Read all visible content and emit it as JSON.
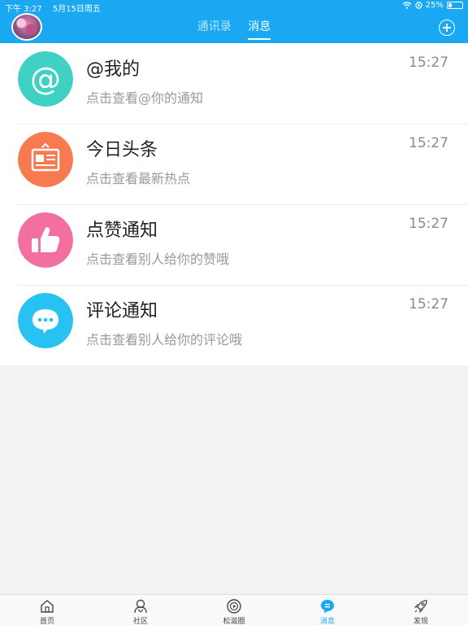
{
  "status": {
    "time": "下午 3:27",
    "date": "5月15日周五",
    "battery": "25%",
    "battery_level": 0.25
  },
  "header": {
    "tabs": [
      {
        "label": "通讯录",
        "active": false
      },
      {
        "label": "消息",
        "active": true
      }
    ]
  },
  "messages": [
    {
      "title": "@我的",
      "subtitle": "点击查看@你的通知",
      "time": "15:27",
      "icon": "at-icon",
      "color": "#3ed1c4"
    },
    {
      "title": "今日头条",
      "subtitle": "点击查看最新热点",
      "time": "15:27",
      "icon": "newspaper-icon",
      "color": "#f87a50"
    },
    {
      "title": "点赞通知",
      "subtitle": "点击查看别人给你的赞哦",
      "time": "15:27",
      "icon": "thumbs-up-icon",
      "color": "#f26fa0"
    },
    {
      "title": "评论通知",
      "subtitle": "点击查看别人给你的评论哦",
      "time": "15:27",
      "icon": "comment-bubble-icon",
      "color": "#27c2f2"
    }
  ],
  "bottom_nav": [
    {
      "label": "首页",
      "icon": "home-icon",
      "active": false
    },
    {
      "label": "社区",
      "icon": "community-icon",
      "active": false
    },
    {
      "label": "松滋圈",
      "icon": "circle-icon",
      "active": false
    },
    {
      "label": "消息",
      "icon": "message-icon",
      "active": true
    },
    {
      "label": "发现",
      "icon": "rocket-icon",
      "active": false
    }
  ],
  "colors": {
    "accent": "#1aa8f2",
    "background": "#f2f2f2"
  }
}
